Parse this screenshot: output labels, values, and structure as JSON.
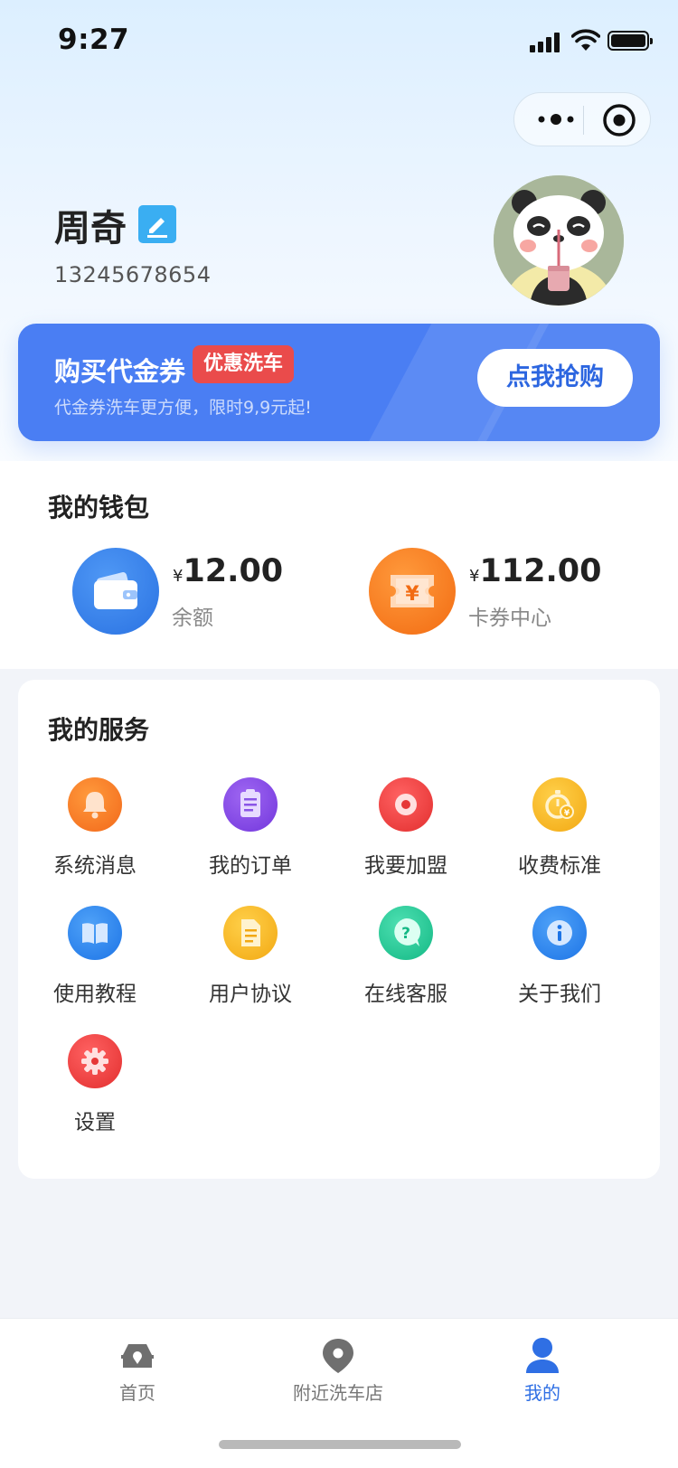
{
  "status_bar": {
    "time": "9:27"
  },
  "profile": {
    "name": "周奇",
    "phone": "13245678654"
  },
  "promo": {
    "title": "购买代金券",
    "badge": "优惠洗车",
    "subtitle": "代金券洗车更方便，限时9,9元起!",
    "button": "点我抢购",
    "color": "#4a7ef3"
  },
  "wallet": {
    "title": "我的钱包",
    "items": [
      {
        "currency": "¥",
        "amount": "12.00",
        "label": "余额",
        "icon": "wallet-icon",
        "color": "#2f7be8"
      },
      {
        "currency": "¥",
        "amount": "112.00",
        "label": "卡券中心",
        "icon": "coupon-icon",
        "color": "#f77f24"
      }
    ]
  },
  "services": {
    "title": "我的服务",
    "items": [
      {
        "label": "系统消息",
        "icon": "bell-icon",
        "color": "#f77f24"
      },
      {
        "label": "我的订单",
        "icon": "clipboard-icon",
        "color": "#8549e6"
      },
      {
        "label": "我要加盟",
        "icon": "record-icon",
        "color": "#ef4040"
      },
      {
        "label": "收费标准",
        "icon": "stopwatch-icon",
        "color": "#f6b41c"
      },
      {
        "label": "使用教程",
        "icon": "book-icon",
        "color": "#2b86ee"
      },
      {
        "label": "用户协议",
        "icon": "document-icon",
        "color": "#f6b41c"
      },
      {
        "label": "在线客服",
        "icon": "help-chat-icon",
        "color": "#22c597"
      },
      {
        "label": "关于我们",
        "icon": "info-icon",
        "color": "#2b86ee"
      },
      {
        "label": "设置",
        "icon": "settings-icon",
        "color": "#ef4040"
      }
    ]
  },
  "tabbar": {
    "items": [
      {
        "label": "首页",
        "icon": "car-home-icon"
      },
      {
        "label": "附近洗车店",
        "icon": "location-pin-icon"
      },
      {
        "label": "我的",
        "icon": "user-icon",
        "active": true
      }
    ],
    "active_color": "#2f6fe4",
    "inactive_color": "#777777"
  }
}
